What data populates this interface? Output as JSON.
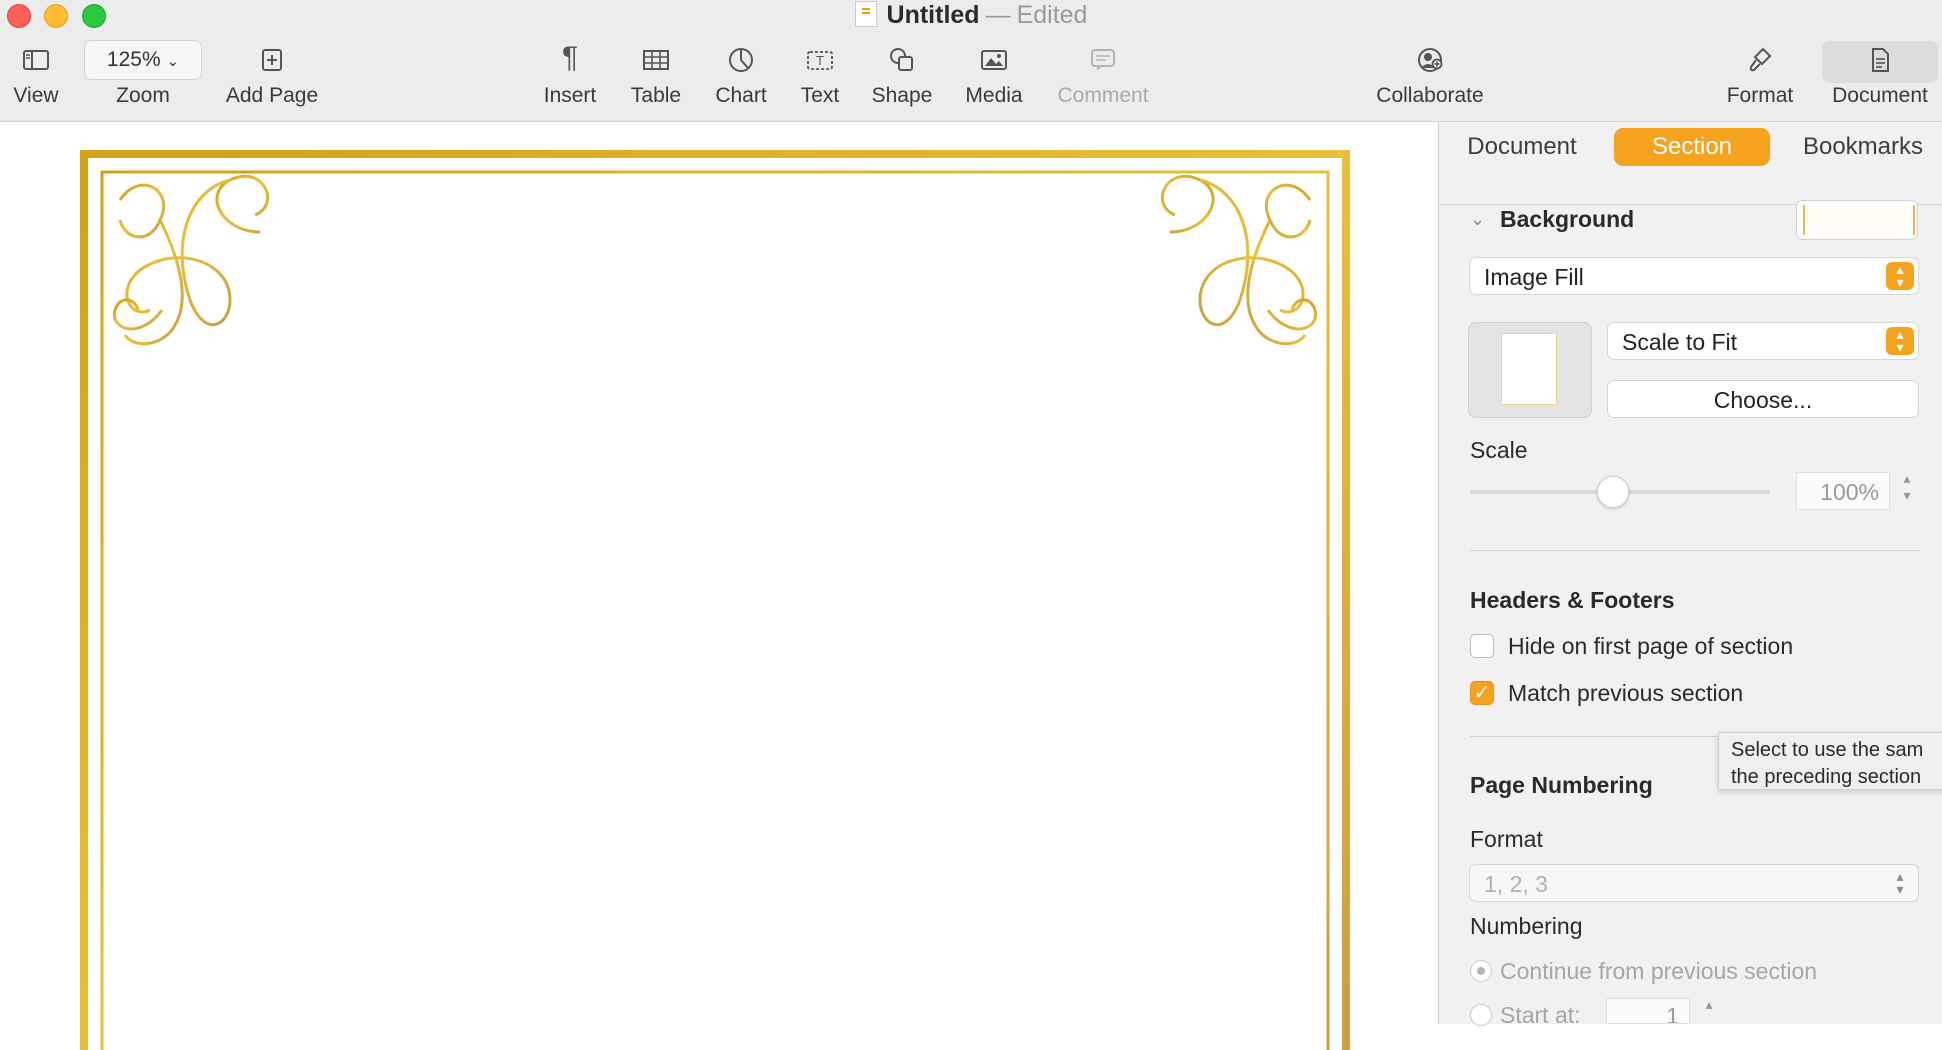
{
  "window": {
    "title": "Untitled",
    "separator": "—",
    "status": "Edited"
  },
  "toolbar": {
    "view": "View",
    "zoom_value": "125%",
    "zoom": "Zoom",
    "add_page": "Add Page",
    "insert": "Insert",
    "table": "Table",
    "chart": "Chart",
    "text": "Text",
    "shape": "Shape",
    "media": "Media",
    "comment": "Comment",
    "collaborate": "Collaborate",
    "format": "Format",
    "document": "Document"
  },
  "inspector": {
    "tabs": [
      {
        "label": "Document"
      },
      {
        "label": "Section"
      },
      {
        "label": "Bookmarks"
      }
    ],
    "background": {
      "heading": "Background",
      "fill_type": "Image Fill",
      "scale_mode": "Scale to Fit",
      "choose_label": "Choose...",
      "scale_label": "Scale",
      "scale_value": "100%",
      "scale_fraction": 0.4
    },
    "headers_footers": {
      "heading": "Headers & Footers",
      "hide_first": "Hide on first page of section",
      "hide_first_checked": false,
      "match_previous": "Match previous section",
      "match_previous_checked": true
    },
    "tooltip": {
      "line1": "Select to use the sam",
      "line2": "the preceding section"
    },
    "page_numbering": {
      "heading": "Page Numbering",
      "format_label": "Format",
      "format_value": "1, 2, 3",
      "numbering_label": "Numbering",
      "continue": "Continue from previous section",
      "start_at": "Start at:",
      "start_value": "1"
    }
  },
  "colors": {
    "accent": "#f5a31f",
    "gold": "#d9a520"
  }
}
